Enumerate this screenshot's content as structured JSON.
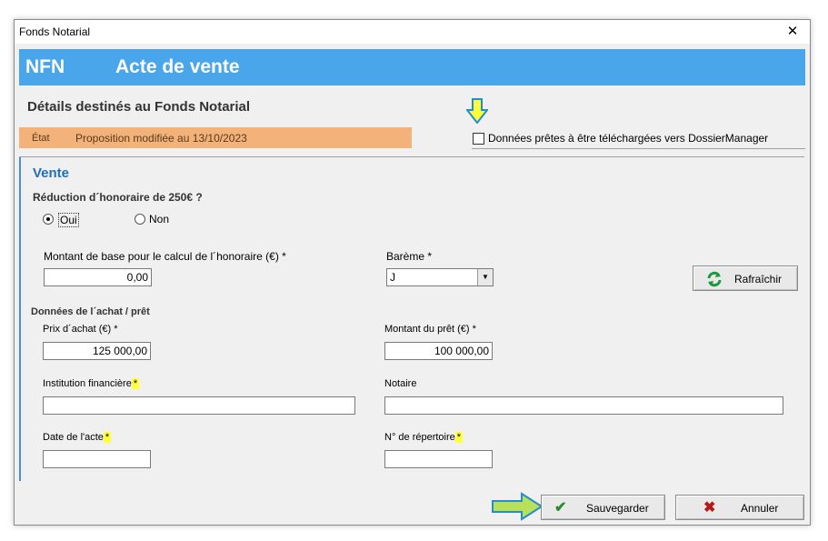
{
  "window": {
    "title": "Fonds Notarial",
    "close": "✕"
  },
  "banner": {
    "code": "NFN",
    "title": "Acte de vente"
  },
  "section_title": "Détails destinés au Fonds Notarial",
  "state": {
    "label": "État",
    "value": "Proposition modifiée au 13/10/2023",
    "color": "#f3b27a"
  },
  "ready": {
    "label": "Données prêtes à être téléchargées vers DossierManager",
    "checked": false
  },
  "vente": {
    "title": "Vente",
    "reduction_question": "Réduction d´honoraire de 250€ ?",
    "options": {
      "yes": "Oui",
      "no": "Non",
      "selected": "Oui"
    },
    "base_amount_label": "Montant de base pour le calcul de l´honoraire (€) *",
    "base_amount_value": "0,00",
    "bareme_label": "Barème *",
    "bareme_value": "J",
    "refresh_label": "Rafraîchir"
  },
  "achat": {
    "group_title": "Données de l´achat / prêt",
    "prix_label": "Prix d´achat (€) *",
    "prix_value": "125 000,00",
    "pret_label": "Montant du prêt (€) *",
    "pret_value": "100 000,00",
    "institution_label": "Institution financière",
    "notaire_label": "Notaire",
    "date_label": "Date de l'acte",
    "repertoire_label": "N° de répertoire",
    "required_marker": "*",
    "institution_value": "",
    "notaire_value": "",
    "date_value": "",
    "repertoire_value": ""
  },
  "actions": {
    "save": "Sauvegarder",
    "cancel": "Annuler"
  },
  "colors": {
    "banner": "#4aa6ea",
    "accent": "#1f6fba",
    "highlight": "#ffff3a",
    "arrow": "#ffff3a"
  },
  "icons": {
    "refresh": "refresh-icon",
    "save": "check-icon",
    "cancel": "cross-icon"
  }
}
